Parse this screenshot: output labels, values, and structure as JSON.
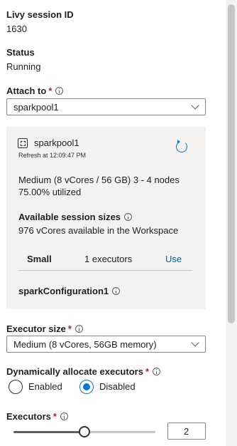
{
  "session": {
    "id_label": "Livy session ID",
    "id_value": "1630",
    "status_label": "Status",
    "status_value": "Running"
  },
  "attach_to": {
    "label": "Attach to",
    "required_mark": "*",
    "value": "sparkpool1"
  },
  "pool": {
    "name": "sparkpool1",
    "refresh_text": "Refresh at 12:09:47 PM",
    "description": "Medium (8 vCores / 56 GB) 3 - 4 nodes",
    "utilization": "75.00% utilized",
    "available_sizes_title": "Available session sizes",
    "available_sizes_desc": "976 vCores available in the Workspace",
    "sizes": [
      {
        "name": "Small",
        "executors": "1 executors",
        "action": "Use"
      }
    ],
    "spark_configuration": "sparkConfiguration1"
  },
  "executor_size": {
    "label": "Executor size",
    "required_mark": "*",
    "value": "Medium (8 vCores, 56GB memory)"
  },
  "dynamic_allocation": {
    "label": "Dynamically allocate executors",
    "required_mark": "*",
    "options": [
      "Enabled",
      "Disabled"
    ],
    "selected": "Disabled"
  },
  "executors": {
    "label": "Executors",
    "required_mark": "*",
    "value": "2",
    "slider_fraction": 0.5
  },
  "colors": {
    "accent": "#0078d4",
    "link": "#0062ad",
    "required": "#a4262c",
    "card_bg": "#f3f2f1"
  }
}
